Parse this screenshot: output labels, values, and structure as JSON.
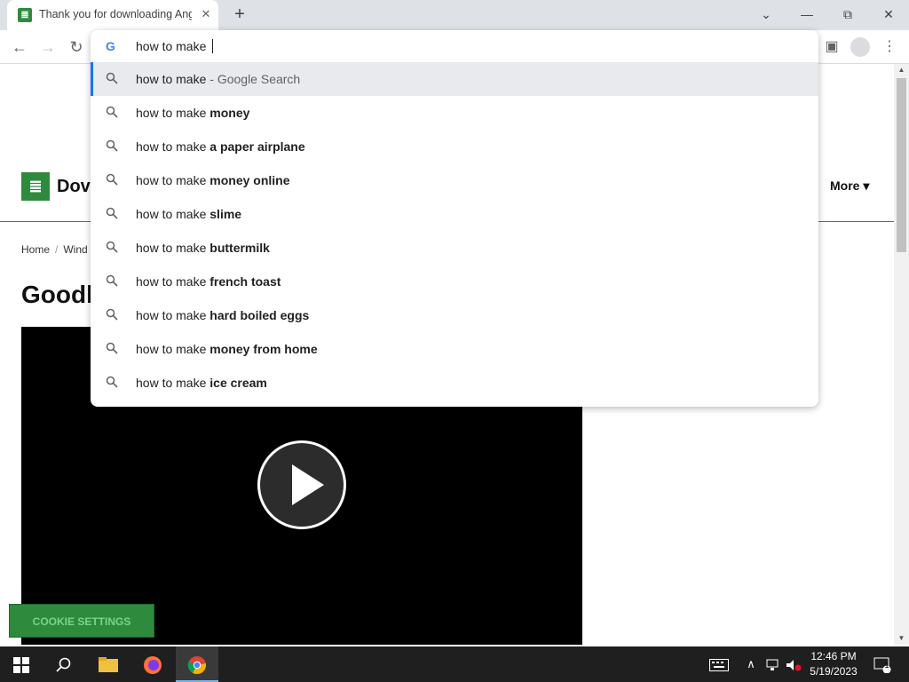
{
  "browser": {
    "tab_title": "Thank you for downloading Ang",
    "tab_favicon": "≣",
    "tab_close": "✕",
    "new_tab": "+",
    "window_controls": {
      "dropdown": "⌄",
      "minimize": "—",
      "restore": "⧉",
      "close": "✕"
    },
    "nav": {
      "back": "←",
      "forward": "→",
      "reload": "↻"
    },
    "google_logo": "G",
    "omnibox_text": "how to make ",
    "sidepanel_icon": "▣",
    "menu_icon": "⋮"
  },
  "suggestions": [
    {
      "prefix": "how to make",
      "suffix": " - Google Search",
      "style": "dim"
    },
    {
      "prefix": "how to make ",
      "suffix": "money",
      "style": "bold"
    },
    {
      "prefix": "how to make ",
      "suffix": "a paper airplane",
      "style": "bold"
    },
    {
      "prefix": "how to make ",
      "suffix": "money online",
      "style": "bold"
    },
    {
      "prefix": "how to make ",
      "suffix": "slime",
      "style": "bold"
    },
    {
      "prefix": "how to make ",
      "suffix": "buttermilk",
      "style": "bold"
    },
    {
      "prefix": "how to make ",
      "suffix": "french toast",
      "style": "bold"
    },
    {
      "prefix": "how to make ",
      "suffix": "hard boiled eggs",
      "style": "bold"
    },
    {
      "prefix": "how to make ",
      "suffix": "money from home",
      "style": "bold"
    },
    {
      "prefix": "how to make ",
      "suffix": "ice cream",
      "style": "bold"
    }
  ],
  "page": {
    "logo_glyph": "≣",
    "site_name_visible": "Dov",
    "more_label": "More",
    "more_caret": "▾",
    "breadcrumb": [
      "Home",
      "Wind"
    ],
    "breadcrumb_sep": "/",
    "heading_visible": "Goodb",
    "cookie_button": "COOKIE SETTINGS"
  },
  "scrollbar": {
    "up": "▲",
    "down": "▼"
  },
  "taskbar": {
    "start_icon": "windows-icon",
    "time": "12:46 PM",
    "date": "5/19/2023",
    "tray_up": "∧",
    "notification_count": "1"
  },
  "colors": {
    "brand_green": "#2e8b3d",
    "selection_blue": "#1a73e8"
  }
}
